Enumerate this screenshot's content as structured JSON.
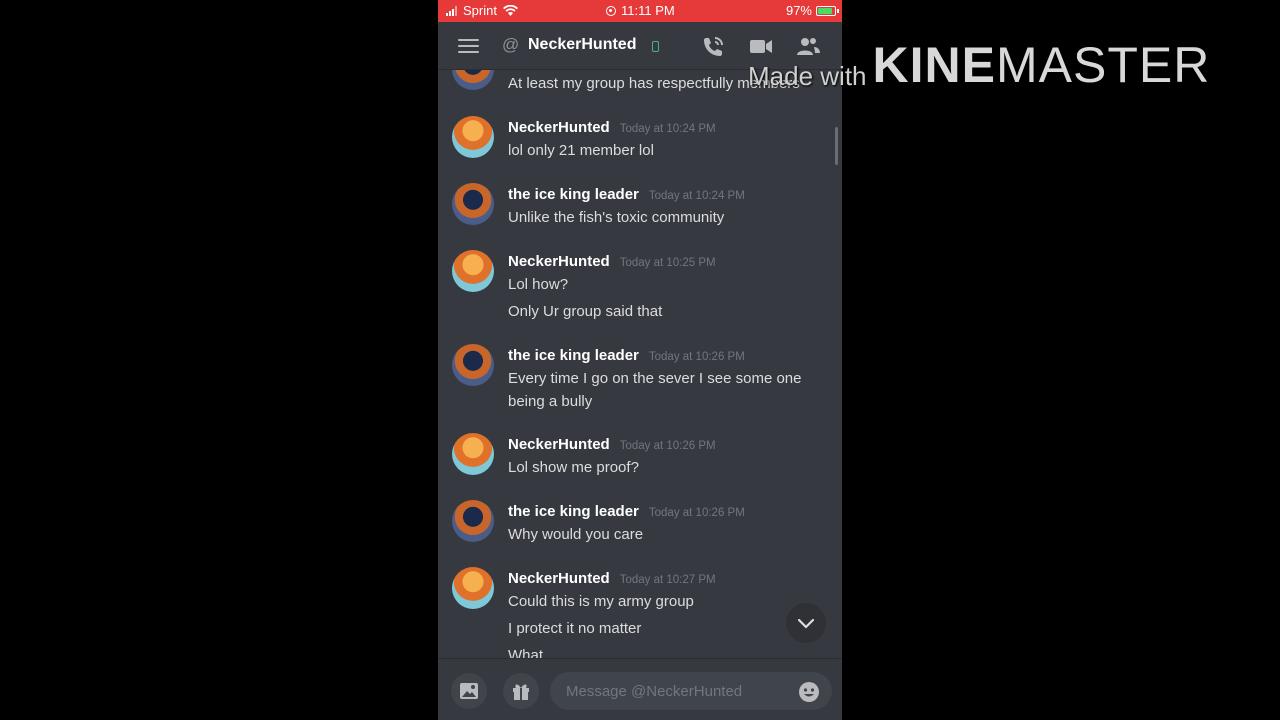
{
  "status_bar": {
    "carrier": "Sprint",
    "time": "11:11 PM",
    "battery": "97%"
  },
  "header": {
    "title": "NeckerHunted",
    "at_symbol": "@"
  },
  "messages": [
    {
      "author": "",
      "timestamp": "",
      "lines": [
        "At least my group has respectfully members"
      ],
      "avatar": "ice"
    },
    {
      "author": "NeckerHunted",
      "timestamp": "Today at 10:24 PM",
      "lines": [
        "lol only 21 member lol"
      ],
      "avatar": "necker"
    },
    {
      "author": "the ice king leader",
      "timestamp": "Today at 10:24 PM",
      "lines": [
        "Unlike the fish's toxic community"
      ],
      "avatar": "ice"
    },
    {
      "author": "NeckerHunted",
      "timestamp": "Today at 10:25 PM",
      "lines": [
        "Lol how?",
        "Only Ur group said that"
      ],
      "avatar": "necker"
    },
    {
      "author": "the ice king leader",
      "timestamp": "Today at 10:26 PM",
      "lines": [
        "Every time I go on the sever I see some one",
        "being a bully"
      ],
      "avatar": "ice"
    },
    {
      "author": "NeckerHunted",
      "timestamp": "Today at 10:26 PM",
      "lines": [
        "Lol show me proof?"
      ],
      "avatar": "necker"
    },
    {
      "author": "the ice king leader",
      "timestamp": "Today at 10:26 PM",
      "lines": [
        "Why would you care"
      ],
      "avatar": "ice"
    },
    {
      "author": "NeckerHunted",
      "timestamp": "Today at 10:27 PM",
      "lines": [
        "Could this is my army group",
        "I protect it no matter",
        "What"
      ],
      "avatar": "necker"
    }
  ],
  "composer": {
    "placeholder": "Message @NeckerHunted"
  },
  "watermark": {
    "made_with": "Made with",
    "brand_bold": "KINE",
    "brand_light": "MASTER"
  },
  "colors": {
    "status_bar": "#e63939",
    "background": "#36393f",
    "mobile_indicator": "#43b581"
  }
}
